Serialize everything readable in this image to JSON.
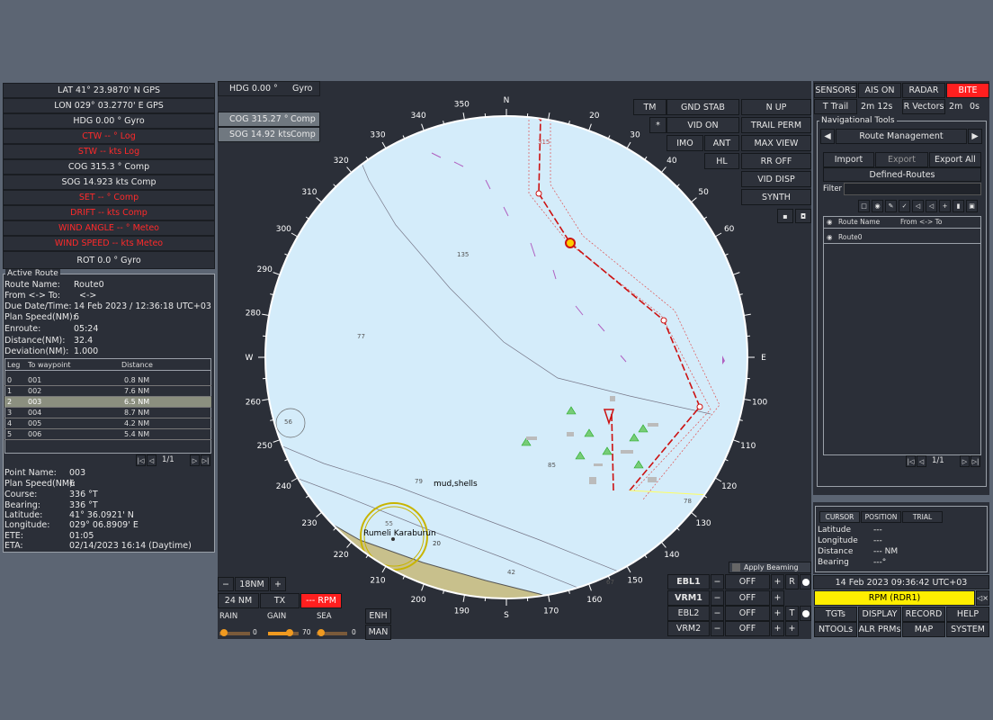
{
  "nav_data": {
    "lat": "LAT 41° 23.9870' N  GPS",
    "lon": "LON 029° 03.2770' E  GPS",
    "hdg": "HDG  0.00 °   Gyro",
    "ctw": "CTW  -- °   Log",
    "stw": "STW  -- kts   Log",
    "cog": "COG  315.3 °   Comp",
    "sog": "SOG  14.923 kts   Comp",
    "set": "SET  -- °   Comp",
    "drift": "DRIFT  -- kts   Comp",
    "wind_angle": "WIND ANGLE  -- °   Meteo",
    "wind_speed": "WIND SPEED  -- kts  Meteo",
    "rot": "ROT  0.0 °  Gyro"
  },
  "active_route": {
    "title": "Active Route",
    "route_name_label": "Route Name:",
    "route_name": "Route0",
    "from_to_label": "From <-> To:",
    "from_to": "<->",
    "due_label": "Due Date/Time:",
    "due": "14 Feb 2023   /   12:36:18 UTC+03",
    "plan_speed_label": "Plan Speed(NM):",
    "plan_speed": "6",
    "enroute_label": "Enroute:",
    "enroute": "05:24",
    "distance_label": "Distance(NM):",
    "distance": "32.4",
    "deviation_label": "Deviation(NM):",
    "deviation": "1.000",
    "legs_headers": [
      "Leg",
      "To waypoint",
      "Distance"
    ],
    "legs": [
      {
        "leg": "0",
        "wp": "001",
        "dist": "0.8 NM"
      },
      {
        "leg": "1",
        "wp": "002",
        "dist": "7.6 NM"
      },
      {
        "leg": "2",
        "wp": "003",
        "dist": "6.5 NM"
      },
      {
        "leg": "3",
        "wp": "004",
        "dist": "8.7 NM"
      },
      {
        "leg": "4",
        "wp": "005",
        "dist": "4.2 NM"
      },
      {
        "leg": "5",
        "wp": "006",
        "dist": "5.4 NM"
      }
    ],
    "page": "1/1",
    "point_name_label": "Point Name:",
    "point_name": "003",
    "pt_plan_speed_label": "Plan Speed(NM):",
    "pt_plan_speed": "6",
    "course_label": "Course:",
    "course": "336 °T",
    "bearing_label": "Bearing:",
    "bearing": "336 °T",
    "latitude_label": "Latitude:",
    "latitude": "41° 36.0921' N",
    "longitude_label": "Longitude:",
    "longitude": "029° 06.8909' E",
    "ete_label": "ETE:",
    "ete": "01:05",
    "eta_label": "ETA:",
    "eta": "02/14/2023 16:14 (Daytime)"
  },
  "top_left_info": {
    "hdg": "HDG  0.00 °",
    "hdg_src": "Gyro",
    "cog": "COG  315.27 °",
    "cog_src": "Comp",
    "sog": "SOG  14.92 kts",
    "sog_src": "Comp"
  },
  "radar_controls": {
    "tm": "TM",
    "gnd_stab": "GND STAB",
    "n_up": "N UP",
    "star": "*",
    "vid_on": "VID ON",
    "trail_perm": "TRAIL PERM",
    "imo": "IMO",
    "ant": "ANT",
    "max_view": "MAX VIEW",
    "hl": "HL",
    "rr_off": "RR OFF",
    "vid_disp": "VID DISP",
    "synth": "SYNTH"
  },
  "chart_labels": {
    "depth_135": "135",
    "depth_77": "77",
    "depth_56": "56",
    "depth_85": "85",
    "depth_79": "79",
    "depth_78": "78",
    "depth_67": "67",
    "depth_42": "42",
    "depth_20": "20",
    "depth_55": "55",
    "depth_315": "315",
    "mud": "mud,shells",
    "place": "Rumeli Karaburun"
  },
  "bearing_ticks": [
    "340",
    "350",
    "N",
    "330",
    "320",
    "310",
    "300",
    "290",
    "280",
    "W",
    "260",
    "250",
    "240",
    "230",
    "220",
    "210",
    "200",
    "190",
    "S",
    "170",
    "160",
    "150",
    "140",
    "130",
    "120",
    "110",
    "100",
    "E",
    "60",
    "50",
    "40",
    "30",
    "20"
  ],
  "bottom_left": {
    "range_minus": "−",
    "range": "18NM",
    "range_plus": "+",
    "rings": "24 NM",
    "tx": "TX",
    "rpm": "--- RPM",
    "rain": "RAIN",
    "gain": "GAIN",
    "sea": "SEA",
    "rain_val": "0",
    "gain_val": "70",
    "sea_val": "0",
    "enh": "ENH",
    "man": "MAN",
    "gain_level": 0.7
  },
  "bottom_center": {
    "apply_beaming": "Apply Beaming",
    "ebl1": "EBL1",
    "vrm1": "VRM1",
    "ebl2": "EBL2",
    "vrm2": "VRM2",
    "off": "OFF",
    "r": "R",
    "t": "T",
    "minus": "−",
    "plus": "+"
  },
  "right_top": {
    "sensors": "SENSORS",
    "ais_on": "AIS ON",
    "radar": "RADAR",
    "bite": "BITE",
    "t_trail": "T Trail",
    "trail_time": "2m 12s",
    "r_vectors": "R Vectors",
    "vec_time": "2m",
    "vec_s": "0s",
    "nav_tools": "Navigational Tools",
    "route_mgmt": "Route Management",
    "import": "Import",
    "export": "Export",
    "export_all": "Export All",
    "defined_routes": "Defined-Routes",
    "filter": "Filter",
    "col_route": "Route Name",
    "col_from": "From <-> To",
    "route0": "Route0",
    "page": "1/1",
    "bite_color": "#ff1f1f"
  },
  "cursor_panel": {
    "tab_cursor": "CURSOR",
    "tab_position": "POSITION",
    "tab_trial": "TRIAL",
    "lat_label": "Latitude",
    "lat": "---",
    "lon_label": "Longitude",
    "lon": "---",
    "dist_label": "Distance",
    "dist": "--- NM",
    "bearing_label": "Bearing",
    "bearing": "---°"
  },
  "status": {
    "datetime": "14 Feb 2023  09:36:42 UTC+03",
    "rpm": "RPM (RDR1)",
    "rpm_color": "#ffee00"
  },
  "menu": {
    "tgts": "TGTs",
    "display": "DISPLAY",
    "record": "RECORD",
    "help": "HELP",
    "ntools": "NTOOLs",
    "alr": "ALR PRMs",
    "map": "MAP",
    "system": "SYSTEM"
  }
}
